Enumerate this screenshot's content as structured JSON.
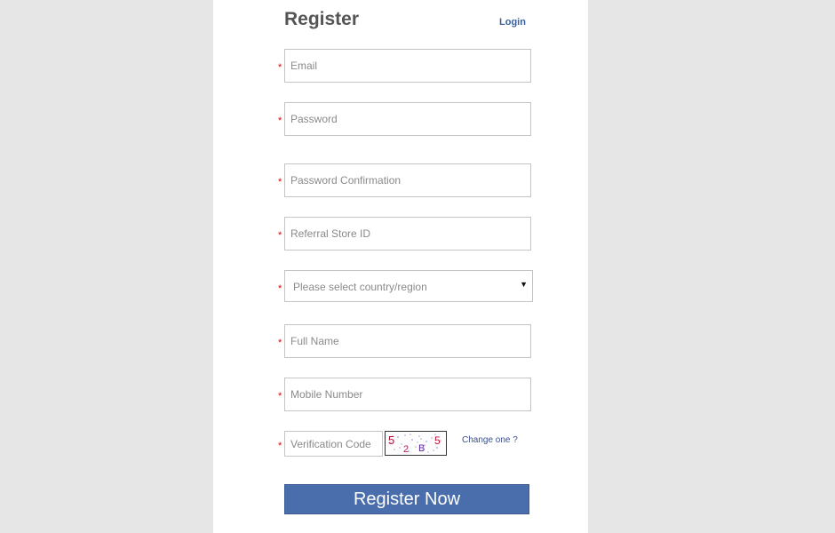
{
  "header": {
    "title": "Register",
    "login_label": "Login"
  },
  "required_marker": "*",
  "fields": {
    "email": {
      "placeholder": "Email",
      "value": ""
    },
    "password": {
      "placeholder": "Password",
      "value": ""
    },
    "password_confirmation": {
      "placeholder": "Password Confirmation",
      "value": ""
    },
    "referral_store_id": {
      "placeholder": "Referral Store ID",
      "value": ""
    },
    "country": {
      "selected": "Please select country/region"
    },
    "full_name": {
      "placeholder": "Full Name",
      "value": ""
    },
    "mobile_number": {
      "placeholder": "Mobile Number",
      "value": ""
    },
    "verification_code": {
      "placeholder": "Verification Code",
      "value": ""
    }
  },
  "captcha": {
    "chars": [
      "5",
      "2",
      "B",
      "5"
    ],
    "change_label": "Change one ?"
  },
  "submit_label": "Register Now",
  "colors": {
    "background": "#e6e6e6",
    "panel": "#ffffff",
    "required": "#e00000",
    "link": "#3a5f9e",
    "button": "#4a6eab"
  }
}
